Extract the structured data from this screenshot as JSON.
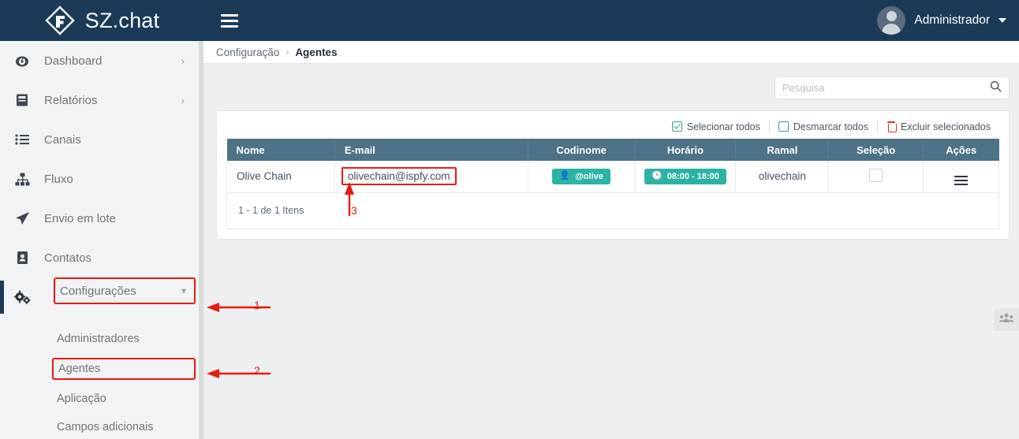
{
  "topbar": {
    "brand": "SZ.chat",
    "logo_icon": "diamond-logo-icon",
    "menu_toggle_icon": "hamburger-menu-icon",
    "user_name": "Administrador",
    "avatar_icon": "user-avatar-icon",
    "caret_icon": "chevron-down-icon"
  },
  "sidebar": {
    "items": [
      {
        "label": "Dashboard",
        "icon": "speedometer-icon",
        "chevron": "›",
        "has_chevron": true,
        "highlighted": false
      },
      {
        "label": "Relatórios",
        "icon": "book-icon",
        "chevron": "›",
        "has_chevron": true,
        "highlighted": false
      },
      {
        "label": "Canais",
        "icon": "list-icon",
        "chevron": "",
        "has_chevron": false,
        "highlighted": false
      },
      {
        "label": "Fluxo",
        "icon": "sitemap-icon",
        "chevron": "",
        "has_chevron": false,
        "highlighted": false
      },
      {
        "label": "Envio em lote",
        "icon": "paper-plane-icon",
        "chevron": "",
        "has_chevron": false,
        "highlighted": false
      },
      {
        "label": "Contatos",
        "icon": "address-book-icon",
        "chevron": "",
        "has_chevron": false,
        "highlighted": false
      },
      {
        "label": "Configurações",
        "icon": "gears-icon",
        "chevron": "∨",
        "has_chevron": true,
        "highlighted": true
      }
    ],
    "sub_items": [
      {
        "label": "Administradores",
        "highlighted": false
      },
      {
        "label": "Agentes",
        "highlighted": true
      },
      {
        "label": "Aplicação",
        "highlighted": false
      },
      {
        "label": "Campos adicionais",
        "highlighted": false
      }
    ]
  },
  "breadcrumb": {
    "root": "Configuração",
    "separator": "›",
    "current": "Agentes"
  },
  "search": {
    "placeholder": "Pesquisa",
    "value": "",
    "icon": "search-icon"
  },
  "toolbar": {
    "select_all": "Selecionar todos",
    "select_all_icon": "checked-checkbox-icon",
    "deselect_all": "Desmarcar todos",
    "deselect_all_icon": "empty-checkbox-icon",
    "delete_selected": "Excluir selecionados",
    "delete_icon": "trash-icon"
  },
  "table": {
    "headers": [
      "Nome",
      "E-mail",
      "Codinome",
      "Horário",
      "Ramal",
      "Seleção",
      "Ações"
    ],
    "rows": [
      {
        "nome": "Olive Chain",
        "email": "olivechain@ispfy.com",
        "codinome": "@olive",
        "codinome_icon": "user-icon",
        "horario": "08:00 - 18:00",
        "horario_icon": "clock-icon",
        "ramal": "olivechain",
        "selecao_icon": "row-checkbox-icon",
        "acoes_icon": "hamburger-actions-icon"
      }
    ],
    "footer": "1 - 1 de 1 Itens"
  },
  "fab": {
    "icon": "users-group-icon"
  },
  "annotations": [
    {
      "number": "1"
    },
    {
      "number": "2"
    },
    {
      "number": "3"
    }
  ],
  "colors": {
    "topbar": "#1b3a57",
    "table_header": "#4e7287",
    "pill": "#2bb3a3",
    "annotation": "#e81a0c"
  }
}
